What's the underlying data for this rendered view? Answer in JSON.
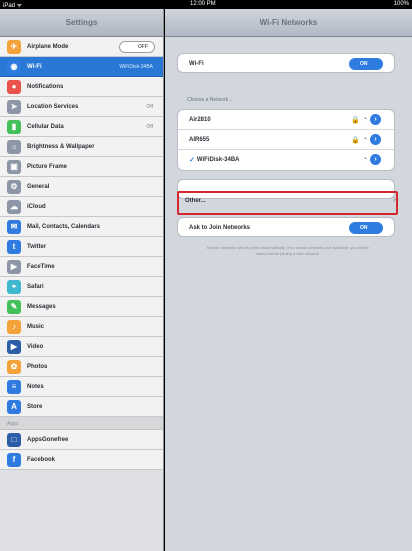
{
  "status": {
    "left": "iPad ᯤ",
    "time": "12:00 PM",
    "right": "100%"
  },
  "sidebar": {
    "title": "Settings",
    "items": [
      {
        "label": "Airplane Mode",
        "value": "OFF",
        "icon": "airplane-icon",
        "color": "orange",
        "toggle": true
      },
      {
        "label": "Wi-Fi",
        "value": "WiFiDisk-34BA",
        "icon": "wifi-icon",
        "color": "blue",
        "selected": true
      },
      {
        "label": "Notifications",
        "value": "",
        "icon": "notifications-icon",
        "color": "red"
      },
      {
        "label": "Location Services",
        "value": "Off",
        "icon": "location-icon",
        "color": "gray"
      },
      {
        "label": "Cellular Data",
        "value": "Off",
        "icon": "cellular-icon",
        "color": "green"
      },
      {
        "label": "Brightness & Wallpaper",
        "value": "",
        "icon": "brightness-icon",
        "color": "gray"
      },
      {
        "label": "Picture Frame",
        "value": "",
        "icon": "picture-frame-icon",
        "color": "gray"
      },
      {
        "label": "General",
        "value": "",
        "icon": "gear-icon",
        "color": "gray"
      },
      {
        "label": "iCloud",
        "value": "",
        "icon": "cloud-icon",
        "color": "gray"
      },
      {
        "label": "Mail, Contacts, Calendars",
        "value": "",
        "icon": "mail-icon",
        "color": "blue"
      },
      {
        "label": "Twitter",
        "value": "",
        "icon": "twitter-icon",
        "color": "blue"
      },
      {
        "label": "FaceTime",
        "value": "",
        "icon": "facetime-icon",
        "color": "gray"
      },
      {
        "label": "Safari",
        "value": "",
        "icon": "safari-icon",
        "color": "teal"
      },
      {
        "label": "Messages",
        "value": "",
        "icon": "messages-icon",
        "color": "green"
      },
      {
        "label": "Music",
        "value": "",
        "icon": "music-icon",
        "color": "orange"
      },
      {
        "label": "Video",
        "value": "",
        "icon": "video-icon",
        "color": "darkblue"
      },
      {
        "label": "Photos",
        "value": "",
        "icon": "photos-icon",
        "color": "orange"
      },
      {
        "label": "Notes",
        "value": "",
        "icon": "notes-icon",
        "color": "blue"
      },
      {
        "label": "Store",
        "value": "",
        "icon": "store-icon",
        "color": "blue"
      },
      {
        "label": "Apps",
        "value": "",
        "section": true
      },
      {
        "label": "AppsGonefree",
        "value": "",
        "icon": "apps-gonefree-icon",
        "color": "darkblue"
      },
      {
        "label": "Facebook",
        "value": "",
        "icon": "facebook-icon",
        "color": "blue"
      }
    ]
  },
  "detail": {
    "title": "Wi-Fi Networks",
    "wifi_label": "Wi-Fi",
    "wifi_toggle": "ON",
    "choose_label": "Choose a Network...",
    "networks": [
      {
        "name": "Air2810",
        "selected": false
      },
      {
        "name": "AIR655",
        "selected": false
      },
      {
        "name": "WiFiDisk-34BA",
        "selected": true
      }
    ],
    "other_label": "Other...",
    "ask_label": "Ask to Join Networks",
    "ask_toggle": "ON",
    "footnote": "Known networks will be joined automatically. If no known networks are available, you will be asked before joining a new network."
  },
  "colors": {
    "highlight": "#2a78d6",
    "toggle": "#2f7be0",
    "annotation": "#d3262e"
  }
}
